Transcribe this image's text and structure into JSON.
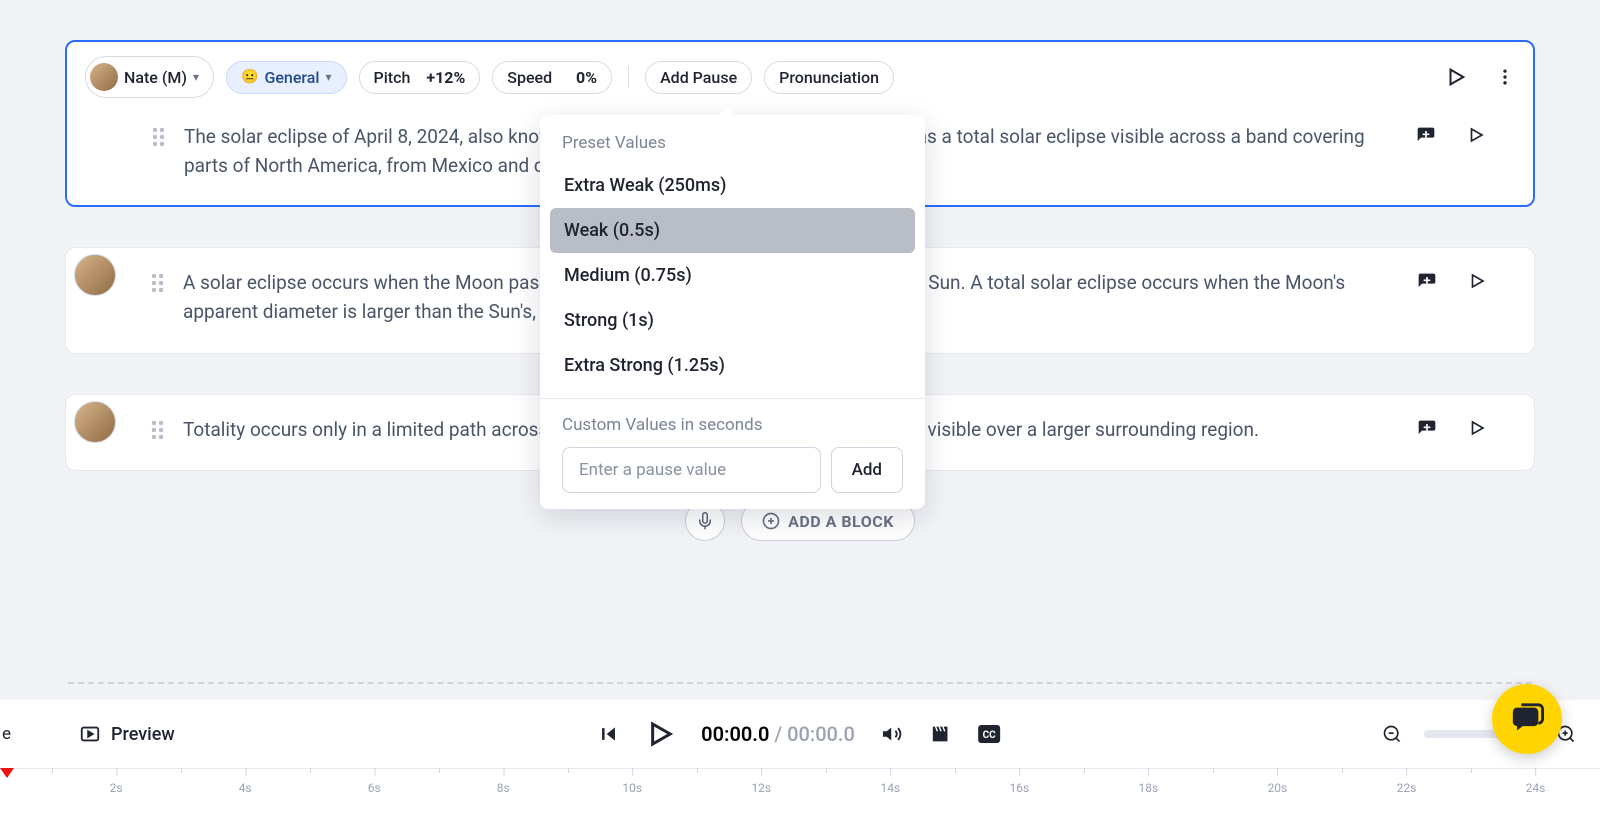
{
  "toolbar": {
    "voice_name": "Nate (M)",
    "general_label": "General",
    "pitch_label": "Pitch",
    "pitch_value": "+12%",
    "speed_label": "Speed",
    "speed_value": "0%",
    "add_pause_label": "Add Pause",
    "pronunciation_label": "Pronunciation"
  },
  "blocks": [
    {
      "text": "The solar eclipse of April 8, 2024, also known as the Great North American eclipse,[a] was a total solar eclipse visible across a band covering parts of North America, from Mexico and crossing the contiguous United States."
    },
    {
      "text": "A solar eclipse occurs when the Moon passes between Earth and the Sun, obscuring the Sun. A total solar eclipse occurs when the Moon's apparent diameter is larger than the Sun's, blocking all direct sunlight."
    },
    {
      "text": "Totality occurs only in a limited path across Earth's surface, with the partial solar eclipse visible over a larger surrounding region."
    }
  ],
  "add_block_label": "ADD A BLOCK",
  "pause_dropdown": {
    "preset_header": "Preset Values",
    "items": [
      "Extra Weak (250ms)",
      "Weak (0.5s)",
      "Medium (0.75s)",
      "Strong (1s)",
      "Extra Strong (1.25s)"
    ],
    "hover_index": 1,
    "custom_header": "Custom Values in seconds",
    "input_placeholder": "Enter a pause value",
    "add_label": "Add"
  },
  "player": {
    "trunc": "e",
    "preview_label": "Preview",
    "time_current": "00:00.0",
    "time_total": "00:00.0"
  },
  "ruler_ticks": [
    "2s",
    "4s",
    "6s",
    "8s",
    "10s",
    "12s",
    "14s",
    "16s",
    "18s",
    "20s",
    "22s",
    "24s"
  ]
}
